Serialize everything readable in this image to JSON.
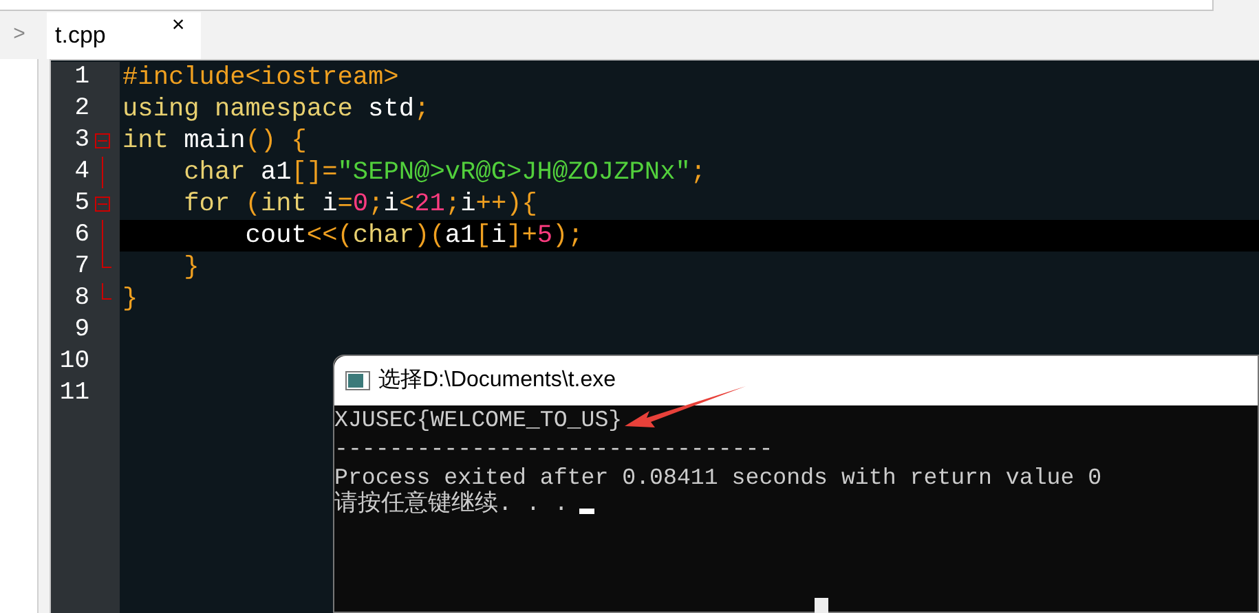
{
  "sidebar": {
    "toggle": ">"
  },
  "tabs": [
    {
      "label": "t.cpp",
      "selected": true,
      "close": "×"
    }
  ],
  "editor": {
    "lines": [
      {
        "number": "1",
        "kind": "plain",
        "tokens": [
          {
            "t": "#include<iostream>",
            "kind": "pre"
          }
        ]
      },
      {
        "number": "2",
        "kind": "plain",
        "tokens": [
          {
            "t": "using namespace ",
            "kind": "kw"
          },
          {
            "t": "std",
            "kind": "plain"
          },
          {
            "t": ";",
            "kind": "punct"
          }
        ]
      },
      {
        "number": "3",
        "kind": "foldstart",
        "tokens": [
          {
            "t": "int ",
            "kind": "kw"
          },
          {
            "t": "main",
            "kind": "plain"
          },
          {
            "t": "() {",
            "kind": "punct"
          }
        ]
      },
      {
        "number": "4",
        "kind": "foldbody",
        "tokens": [
          {
            "t": "    char ",
            "kind": "kw"
          },
          {
            "t": "a1",
            "kind": "plain"
          },
          {
            "t": "[]=",
            "kind": "punct"
          },
          {
            "t": "\"SEPN@>vR@G>JH@ZOJZPNx\"",
            "kind": "str"
          },
          {
            "t": ";",
            "kind": "punct"
          }
        ]
      },
      {
        "number": "5",
        "kind": "foldstart",
        "tokens": [
          {
            "t": "    for ",
            "kind": "kw"
          },
          {
            "t": "(",
            "kind": "punct"
          },
          {
            "t": "int ",
            "kind": "kw"
          },
          {
            "t": "i",
            "kind": "plain"
          },
          {
            "t": "=",
            "kind": "punct"
          },
          {
            "t": "0",
            "kind": "num"
          },
          {
            "t": ";",
            "kind": "punct"
          },
          {
            "t": "i",
            "kind": "plain"
          },
          {
            "t": "<",
            "kind": "punct"
          },
          {
            "t": "21",
            "kind": "num"
          },
          {
            "t": ";",
            "kind": "punct"
          },
          {
            "t": "i",
            "kind": "plain"
          },
          {
            "t": "++){",
            "kind": "punct"
          }
        ]
      },
      {
        "number": "6",
        "kind": "foldbody",
        "current": true,
        "tokens": [
          {
            "t": "        cout",
            "kind": "plain"
          },
          {
            "t": "<<(",
            "kind": "punct"
          },
          {
            "t": "char",
            "kind": "kw"
          },
          {
            "t": ")(",
            "kind": "punct"
          },
          {
            "t": "a1",
            "kind": "plain"
          },
          {
            "t": "[",
            "kind": "punct"
          },
          {
            "t": "i",
            "kind": "plain"
          },
          {
            "t": "]+",
            "kind": "punct"
          },
          {
            "t": "5",
            "kind": "num"
          },
          {
            "t": ");",
            "kind": "punct"
          }
        ]
      },
      {
        "number": "7",
        "kind": "foldend",
        "tokens": [
          {
            "t": "    }",
            "kind": "punct"
          }
        ]
      },
      {
        "number": "8",
        "kind": "foldend",
        "tokens": [
          {
            "t": "}",
            "kind": "punct"
          }
        ]
      },
      {
        "number": "9",
        "kind": "plain"
      },
      {
        "number": "10",
        "kind": "plain"
      },
      {
        "number": "11",
        "kind": "plain"
      }
    ]
  },
  "console": {
    "title": "选择D:\\Documents\\t.exe",
    "output": [
      "XJUSEC{WELCOME_TO_US}",
      "--------------------------------",
      "Process exited after 0.08411 seconds with return value 0"
    ],
    "prompt": "请按任意键继续. . ."
  }
}
